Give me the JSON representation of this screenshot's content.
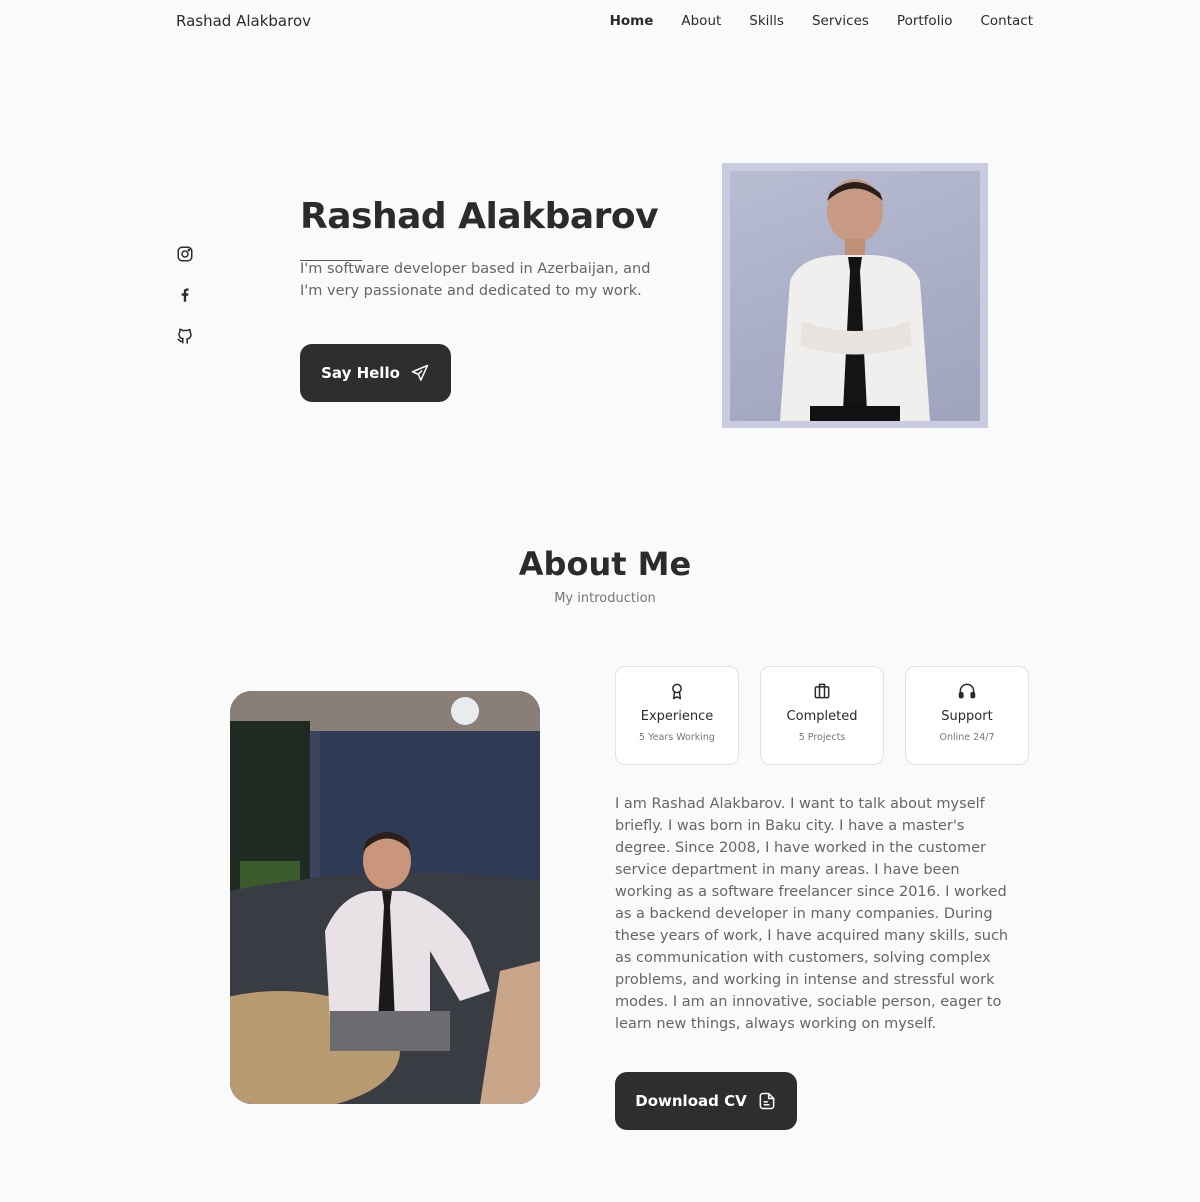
{
  "header": {
    "logo": "Rashad Alakbarov",
    "nav": [
      "Home",
      "About",
      "Skills",
      "Services",
      "Portfolio",
      "Contact"
    ]
  },
  "social": [
    "instagram-icon",
    "facebook-icon",
    "github-icon"
  ],
  "hero": {
    "name": "Rashad Alakbarov",
    "description": "I'm software developer based in Azerbaijan, and I'm very passionate and dedicated to my work.",
    "button": "Say Hello"
  },
  "about": {
    "title": "About Me",
    "subtitle": "My introduction",
    "cards": [
      {
        "title": "Experience",
        "subtitle": "5 Years Working",
        "icon": "award-icon"
      },
      {
        "title": "Completed",
        "subtitle": "5 Projects",
        "icon": "briefcase-icon"
      },
      {
        "title": "Support",
        "subtitle": "Online 24/7",
        "icon": "headset-icon"
      }
    ],
    "text": "I am Rashad Alakbarov. I want to talk about myself briefly. I was born in Baku city. I have a master's degree. Since 2008, I have worked in the customer service department in many areas. I have been working as a software freelancer since 2016. I worked as a backend developer in many companies. During these years of work, I have acquired many skills, such as communication with customers, solving complex problems, and working in intense and stressful work modes. I am an innovative, sociable person, eager to learn new things, always working on myself.",
    "button": "Download CV"
  },
  "colors": {
    "background": "#fafafa",
    "dark": "#2e2e2e",
    "text_muted": "#666666"
  }
}
